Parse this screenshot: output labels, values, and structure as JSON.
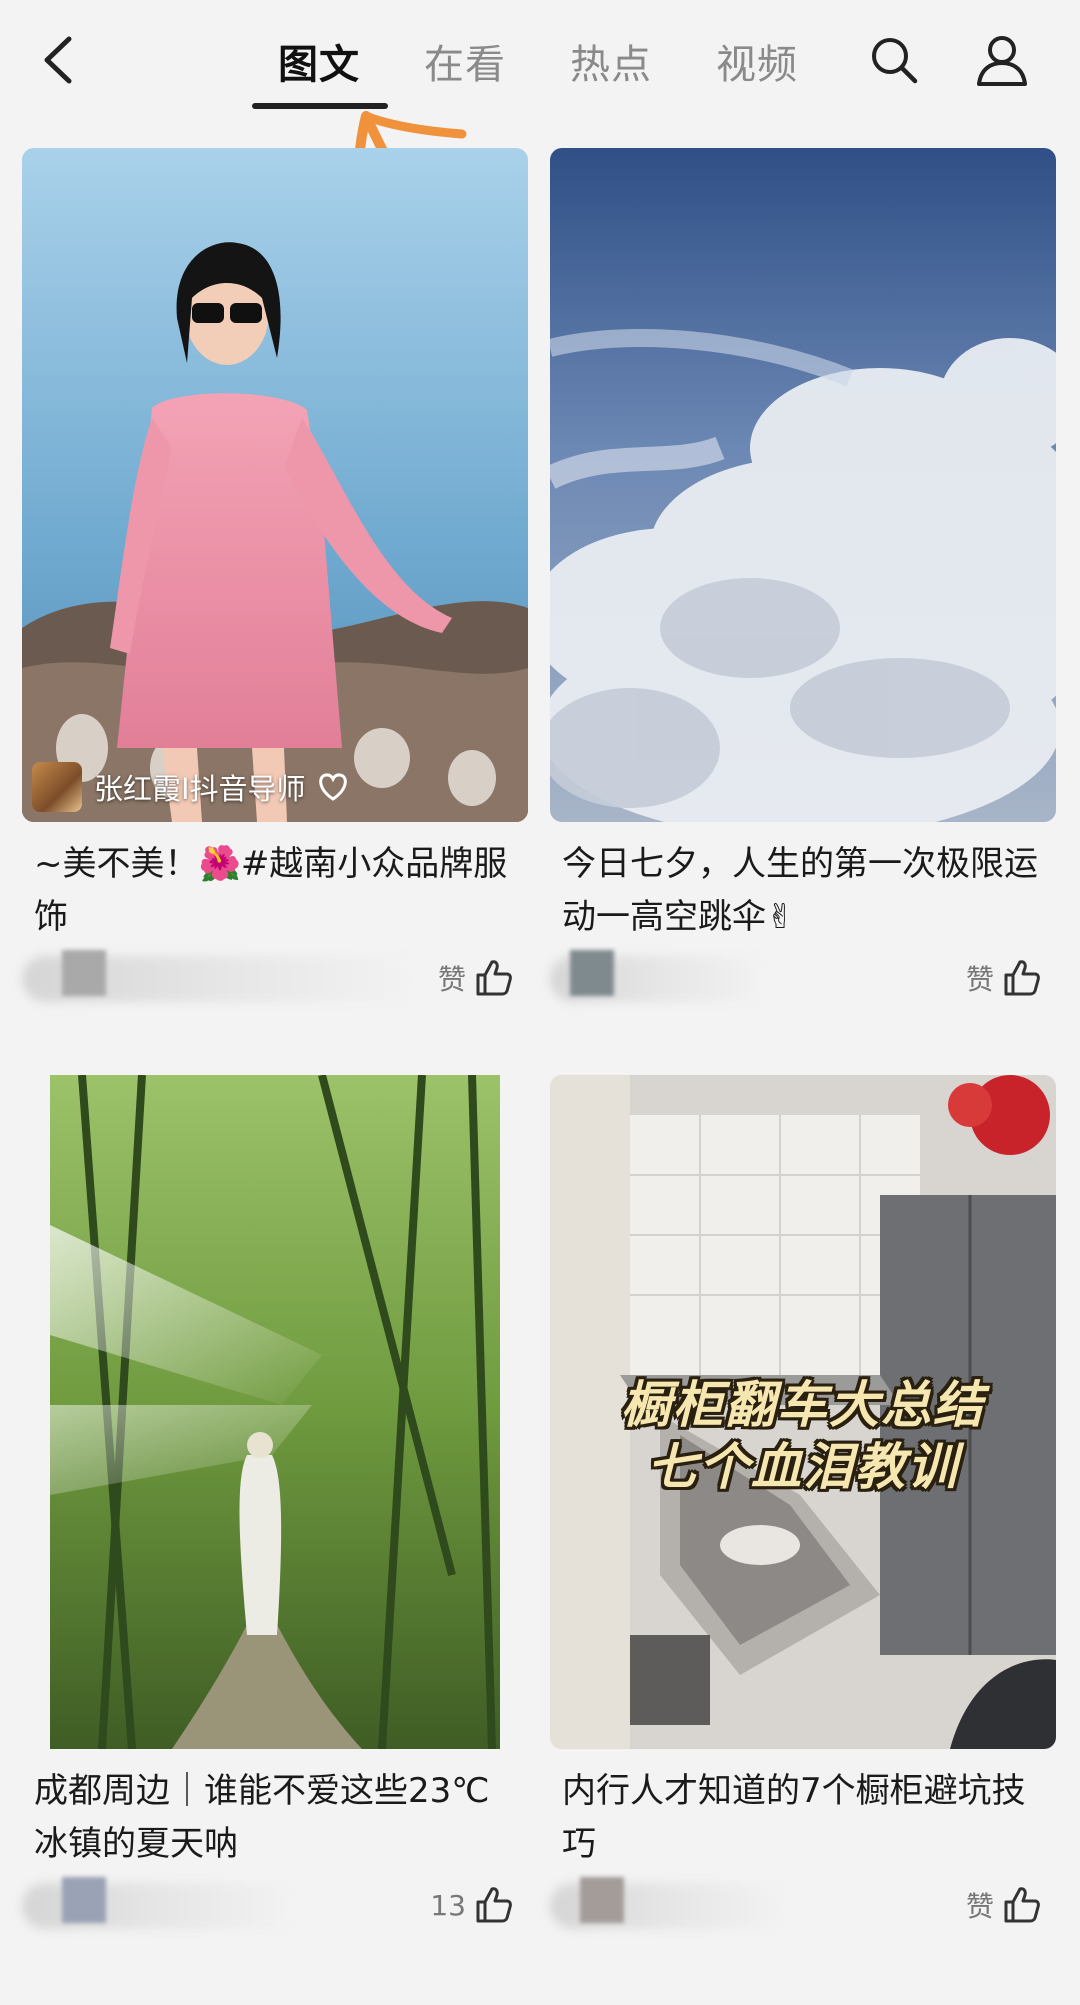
{
  "header": {
    "tabs": [
      {
        "label": "图文",
        "active": true
      },
      {
        "label": "在看",
        "active": false
      },
      {
        "label": "热点",
        "active": false
      },
      {
        "label": "视频",
        "active": false
      }
    ],
    "icons": [
      "back-icon",
      "search-icon",
      "profile-icon"
    ]
  },
  "feed": [
    {
      "title": "~美不美！🌺#越南小众品牌服饰",
      "author": "张红霞I抖音导师",
      "image": "woman-pink-dress-seaside",
      "likes_label": "赞",
      "like_icon": "thumbs-up-icon"
    },
    {
      "title": "今日七夕，人生的第一次极限运动一高空跳伞✌",
      "image": "clouds-sky",
      "likes_label": "赞",
      "like_icon": "thumbs-up-icon"
    },
    {
      "title": "成都周边｜谁能不爱这些23℃冰镇的夏天呐",
      "image": "bamboo-forest-path",
      "likes_label": "13",
      "like_icon": "thumbs-up-icon"
    },
    {
      "title": "内行人才知道的7个橱柜避坑技巧",
      "image": "kitchen-cabinet-drawers",
      "overlay_lines": [
        "橱柜翻车大总结",
        "七个血泪教训"
      ],
      "likes_label": "赞",
      "like_icon": "thumbs-up-icon"
    }
  ],
  "colors": {
    "background": "#f3f3f3",
    "active_tab": "#111111",
    "inactive_tab": "#8a8a8a",
    "annotation": "#f0913c"
  }
}
